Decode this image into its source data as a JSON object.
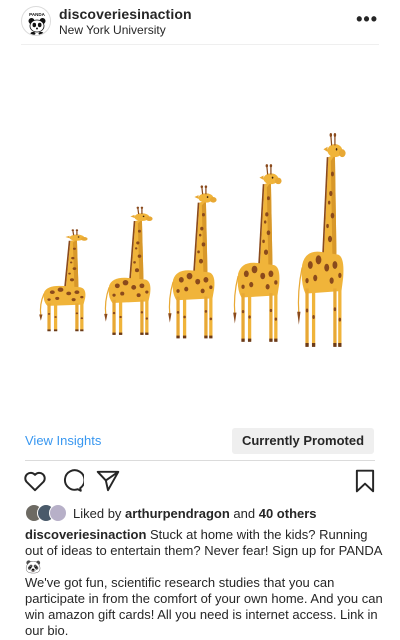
{
  "post": {
    "username": "discoveriesinaction",
    "location": "New York University",
    "avatar_label": "PANDA",
    "more_label": "•••"
  },
  "insights": {
    "view_label": "View Insights",
    "promoted_label": "Currently Promoted"
  },
  "likes": {
    "prefix": "Liked by",
    "user": "arthurpendragon",
    "connector": "and",
    "others": "40 others"
  },
  "caption": {
    "username": "discoveriesinaction",
    "line1": "Stuck at home with the kids? Running out of ideas to entertain them? Never fear! Sign up for PANDA 🐼",
    "line2": "We've got fun, scientific research studies that you can participate in from the comfort of your own home. And you can win amazon gift cards! All you need is internet access. Link in our bio."
  },
  "icons": [
    "heart-icon",
    "comment-icon",
    "share-icon",
    "bookmark-icon",
    "more-icon"
  ],
  "colors": {
    "link": "#3897f0",
    "giraffe_body": "#f0b43a",
    "giraffe_spots": "#8a4a1c",
    "button_bg": "#efefef"
  }
}
